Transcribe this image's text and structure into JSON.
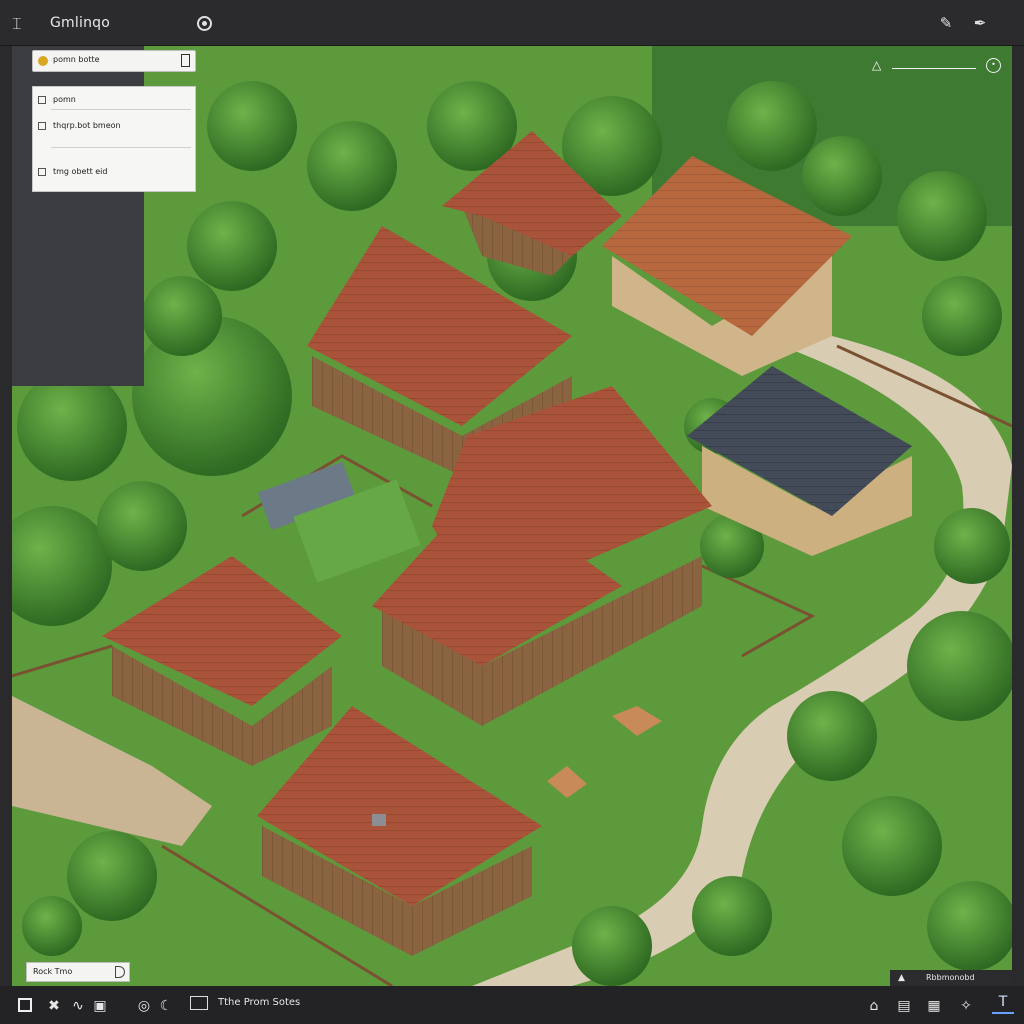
{
  "app": {
    "title": "Gmlinqo"
  },
  "top_toolbar": {
    "left_icon": "grid-icon",
    "info_icon": "info-icon",
    "right_tools": [
      "brush-icon",
      "pen-icon"
    ]
  },
  "layers_panel": {
    "header_label": "pomn botte",
    "rows": [
      {
        "label": "pomn",
        "icon": "layer-checkbox-icon"
      },
      {
        "label": "thqrp.bot bmeon",
        "icon": "layer-checkbox-icon"
      },
      {
        "label": "tmg obett eid",
        "icon": "layer-checkbox-icon"
      }
    ]
  },
  "view_controls": {
    "mountain_icon": "mountain-icon",
    "zoom_icon": "zoom-knob-icon"
  },
  "scene": {
    "badge_label": "Rock Tmo",
    "coord_label": "Rbbmonobd",
    "colors": {
      "grass": "#5f9a3e",
      "road": "#d8ccb2",
      "roof_red": "#a24d35",
      "roof_dark": "#3e4652",
      "tree": "#3f7d2c",
      "wall": "#c8a877"
    }
  },
  "bottom_toolbar": {
    "status_label": "Tthe Prom Sotes",
    "tools": [
      "select-icon",
      "transform-icon",
      "lasso-icon",
      "camera-icon",
      "target-icon",
      "moon-icon",
      "panel-icon"
    ],
    "right_tools": [
      "home-icon",
      "save-icon",
      "layers-icon",
      "magic-icon",
      "text-icon"
    ]
  }
}
